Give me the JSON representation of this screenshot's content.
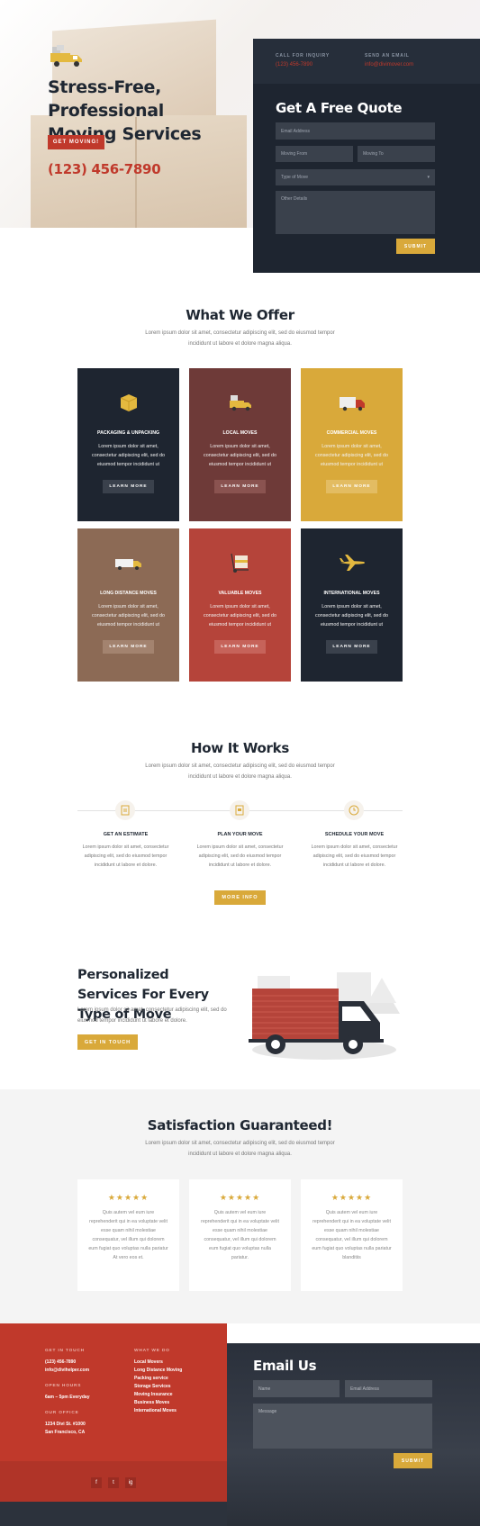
{
  "hero": {
    "title": "Stress-Free, Professional Moving Services",
    "cta": "GET MOVING!",
    "phone": "(123) 456-7890"
  },
  "quote": {
    "call_label": "CALL FOR INQUIRY",
    "call_value": "(123) 456-7890",
    "email_label": "SEND AN EMAIL",
    "email_value": "info@divimover.com",
    "title": "Get A Free Quote",
    "email_placeholder": "Email Address",
    "from_placeholder": "Moving From",
    "to_placeholder": "Moving To",
    "type_placeholder": "Type of Move",
    "details_placeholder": "Other Details",
    "submit": "SUBMIT"
  },
  "offer": {
    "title": "What We Offer",
    "subtitle": "Lorem ipsum dolor sit amet, consectetur adipiscing elit, sed do eiusmod tempor incididunt ut labore et dolore magna aliqua.",
    "cards": [
      {
        "title": "PACKAGING & UNPACKING",
        "text": "Lorem ipsum dolor sit amet, consectetur adipiscing elit, sed do eiusmod tempor incididunt ut",
        "button": "LEARN MORE",
        "bg": "#1e2530",
        "btn_bg": "#3a414c",
        "icon": "box-icon"
      },
      {
        "title": "LOCAL MOVES",
        "text": "Lorem ipsum dolor sit amet, consectetur adipiscing elit, sed do eiusmod tempor incididunt ut",
        "button": "LEARN MORE",
        "bg": "#6e3a38",
        "btn_bg": "#8a5350",
        "icon": "truck-icon"
      },
      {
        "title": "COMMERCIAL MOVES",
        "text": "Lorem ipsum dolor sit amet, consectetur adipiscing elit, sed do eiusmod tempor incididunt ut",
        "button": "LEARN MORE",
        "bg": "#d9a93a",
        "btn_bg": "#e3bc62",
        "icon": "delivery-truck-icon"
      },
      {
        "title": "LONG DISTANCE MOVES",
        "text": "Lorem ipsum dolor sit amet, consectetur adipiscing elit, sed do eiusmod tempor incididunt ut",
        "button": "LEARN MORE",
        "bg": "#8c6a55",
        "btn_bg": "#a3836f",
        "icon": "semi-truck-icon"
      },
      {
        "title": "VALUABLE MOVES",
        "text": "Lorem ipsum dolor sit amet, consectetur adipiscing elit, sed do eiusmod tempor incididunt ut",
        "button": "LEARN MORE",
        "bg": "#b5443a",
        "btn_bg": "#c6635a",
        "icon": "hand-truck-icon"
      },
      {
        "title": "INTERNATIONAL MOVES",
        "text": "Lorem ipsum dolor sit amet, consectetur adipiscing elit, sed do eiusmod tempor incididunt ut",
        "button": "LEARN MORE",
        "bg": "#1e2530",
        "btn_bg": "#3a414c",
        "icon": "airplane-icon"
      }
    ]
  },
  "how": {
    "title": "How It Works",
    "subtitle": "Lorem ipsum dolor sit amet, consectetur adipiscing elit, sed do eiusmod tempor incididunt ut labore et dolore magna aliqua.",
    "steps": [
      {
        "title": "GET AN ESTIMATE",
        "text": "Lorem ipsum dolor sit amet, consectetur adipiscing elit, sed do eiusmod tempor incididunt ut labore et dolore."
      },
      {
        "title": "PLAN YOUR MOVE",
        "text": "Lorem ipsum dolor sit amet, consectetur adipiscing elit, sed do eiusmod tempor incididunt ut labore et dolore."
      },
      {
        "title": "SCHEDULE YOUR MOVE",
        "text": "Lorem ipsum dolor sit amet, consectetur adipiscing elit, sed do eiusmod tempor incididunt ut labore et dolore."
      }
    ],
    "button": "MORE INFO"
  },
  "personal": {
    "title": "Personalized Services For Every Type of Move",
    "text": "Lorem ipsum dolor sit amet, consectetur adipiscing elit, sed do eiusmod tempor incididunt ut labore et dolore.",
    "button": "GET IN TOUCH"
  },
  "testimonials": {
    "title": "Satisfaction Guaranteed!",
    "subtitle": "Lorem ipsum dolor sit amet, consectetur adipiscing elit, sed do eiusmod tempor incididunt ut labore et dolore magna aliqua.",
    "stars": "★★★★★",
    "items": [
      {
        "text": "Quis autem vel eum iure reprehenderit qui in ea voluptate velit esse quam nihil molestiae consequatur, vel illum qui dolorem eum fugiat quo voluptas nulla pariatur At vero eos et."
      },
      {
        "text": "Quis autem vel eum iure reprehenderit qui in ea voluptate velit esse quam nihil molestiae consequatur, vel illum qui dolorem eum fugiat quo voluptas nulla pariatur."
      },
      {
        "text": "Quis autem vel eum iure reprehenderit qui in ea voluptate velit esse quam nihil molestiae consequatur, vel illum qui dolorem eum fugiat quo voluptas nulla pariatur blanditiis"
      }
    ]
  },
  "footer": {
    "touch_label": "GET IN TOUCH",
    "phone": "(123) 456-7890",
    "email": "info@divihelper.com",
    "hours_label": "OPEN HOURS",
    "hours": "6am – 5pm Everyday",
    "office_label": "OUR OFFICE",
    "address1": "1234 Divi St. #1000",
    "address2": "San Francisco, CA",
    "services_label": "WHAT WE DO",
    "services": [
      "Local Movers",
      "Long Distance Moving",
      "Packing service",
      "Storage Services",
      "Moving Insurance",
      "Business Moves",
      "International Moves"
    ],
    "social": [
      "f",
      "t",
      "ig"
    ],
    "email_title": "Email Us",
    "name_placeholder": "Name",
    "email_placeholder": "Email Address",
    "message_placeholder": "Message",
    "submit": "SUBMIT"
  }
}
